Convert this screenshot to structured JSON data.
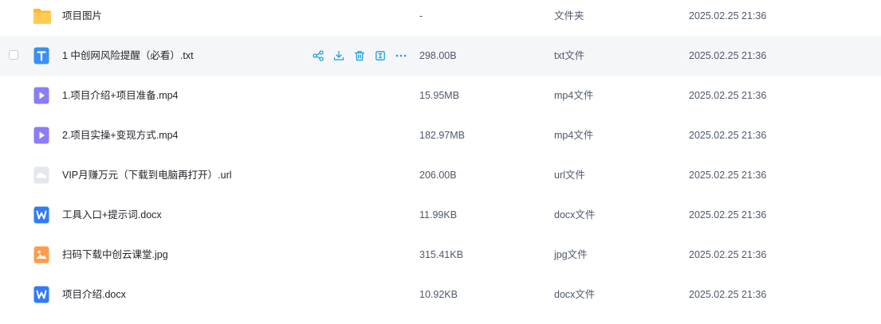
{
  "colors": {
    "folder": "#ffc53d",
    "txt_icon": "#3b8ef5",
    "video_icon": "#8c7cf7",
    "url_icon": "#c9ced6",
    "doc_icon": "#2f7cf6",
    "img_icon": "#ff9c4a",
    "action_icon": "#1ba0e6",
    "row_hover_bg": "#f5f6f8"
  },
  "files": [
    {
      "name": "项目图片",
      "size": "-",
      "type": "文件夹",
      "date": "2025.02.25 21:36",
      "icon": "folder-icon"
    },
    {
      "name": "1 中创网风险提醒（必看）.txt",
      "size": "298.00B",
      "type": "txt文件",
      "date": "2025.02.25 21:36",
      "icon": "txt-file-icon"
    },
    {
      "name": "1.项目介绍+项目准备.mp4",
      "size": "15.95MB",
      "type": "mp4文件",
      "date": "2025.02.25 21:36",
      "icon": "video-file-icon"
    },
    {
      "name": "2.项目实操+变现方式.mp4",
      "size": "182.97MB",
      "type": "mp4文件",
      "date": "2025.02.25 21:36",
      "icon": "video-file-icon"
    },
    {
      "name": "VIP月赚万元（下载到电脑再打开）.url",
      "size": "206.00B",
      "type": "url文件",
      "date": "2025.02.25 21:36",
      "icon": "url-file-icon"
    },
    {
      "name": "工具入口+提示词.docx",
      "size": "11.99KB",
      "type": "docx文件",
      "date": "2025.02.25 21:36",
      "icon": "word-file-icon"
    },
    {
      "name": "扫码下载中创云课堂.jpg",
      "size": "315.41KB",
      "type": "jpg文件",
      "date": "2025.02.25 21:36",
      "icon": "image-file-icon"
    },
    {
      "name": "项目介绍.docx",
      "size": "10.92KB",
      "type": "docx文件",
      "date": "2025.02.25 21:36",
      "icon": "word-file-icon"
    }
  ],
  "row_actions": [
    "share-icon",
    "download-icon",
    "delete-icon",
    "rename-icon",
    "more-icon"
  ]
}
